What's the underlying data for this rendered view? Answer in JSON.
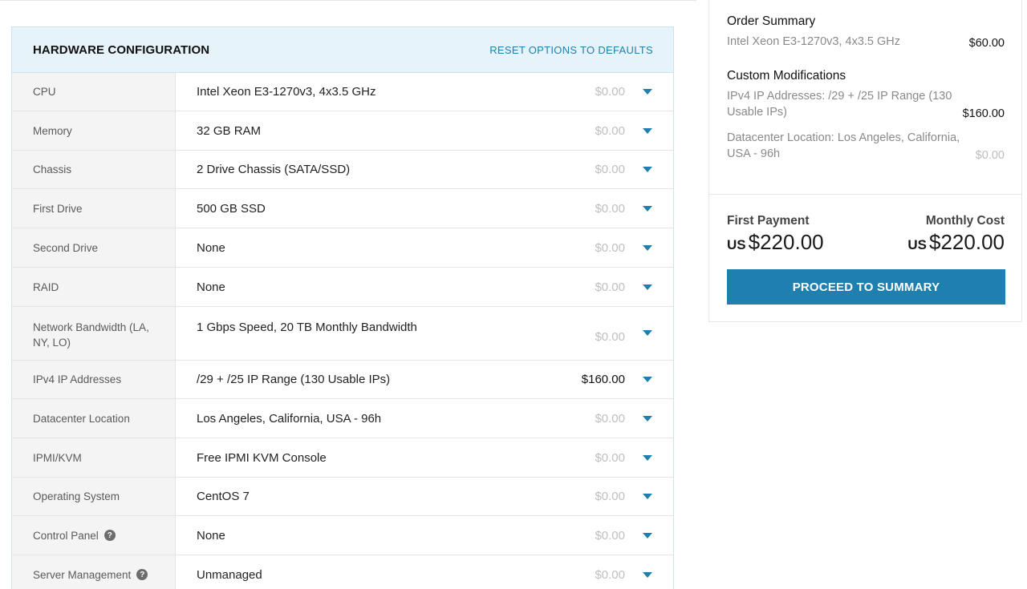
{
  "config": {
    "title": "HARDWARE CONFIGURATION",
    "reset_label": "RESET OPTIONS TO DEFAULTS",
    "rows": [
      {
        "label": "CPU",
        "value": "Intel Xeon E3-1270v3, 4x3.5 GHz",
        "price": "$0.00",
        "active": false,
        "help": false
      },
      {
        "label": "Memory",
        "value": "32 GB RAM",
        "price": "$0.00",
        "active": false,
        "help": false
      },
      {
        "label": "Chassis",
        "value": "2 Drive Chassis (SATA/SSD)",
        "price": "$0.00",
        "active": false,
        "help": false
      },
      {
        "label": "First Drive",
        "value": "500 GB SSD",
        "price": "$0.00",
        "active": false,
        "help": false
      },
      {
        "label": "Second Drive",
        "value": "None",
        "price": "$0.00",
        "active": false,
        "help": false
      },
      {
        "label": "RAID",
        "value": "None",
        "price": "$0.00",
        "active": false,
        "help": false
      },
      {
        "label": "Network Bandwidth (LA, NY, LO)",
        "value": "1 Gbps Speed, 20 TB Monthly Bandwidth",
        "price": "$0.00",
        "active": false,
        "help": false,
        "tall": true
      },
      {
        "label": "IPv4 IP Addresses",
        "value": "/29 + /25 IP Range (130 Usable IPs)",
        "price": "$160.00",
        "active": true,
        "help": false
      },
      {
        "label": "Datacenter Location",
        "value": "Los Angeles, California, USA - 96h",
        "price": "$0.00",
        "active": false,
        "help": false
      },
      {
        "label": "IPMI/KVM",
        "value": "Free IPMI KVM Console",
        "price": "$0.00",
        "active": false,
        "help": false
      },
      {
        "label": "Operating System",
        "value": "CentOS 7",
        "price": "$0.00",
        "active": false,
        "help": false
      },
      {
        "label": "Control Panel",
        "value": "None",
        "price": "$0.00",
        "active": false,
        "help": true
      },
      {
        "label": "Server Management",
        "value": "Unmanaged",
        "price": "$0.00",
        "active": false,
        "help": true
      }
    ]
  },
  "summary": {
    "order_title": "Order Summary",
    "order_item": "Intel Xeon E3-1270v3, 4x3.5 GHz",
    "order_price": "$60.00",
    "custom_title": "Custom Modifications",
    "mods": [
      {
        "desc": "IPv4 IP Addresses: /29 + /25 IP Range (130 Usable IPs)",
        "price": "$160.00",
        "muted": false
      },
      {
        "desc": "Datacenter Location: Los Angeles, California, USA - 96h",
        "price": "$0.00",
        "muted": true
      }
    ],
    "first_payment_label": "First Payment",
    "first_payment_currency": "US",
    "first_payment_amount": "$220.00",
    "monthly_cost_label": "Monthly Cost",
    "monthly_cost_currency": "US",
    "monthly_cost_amount": "$220.00",
    "proceed_label": "PROCEED TO SUMMARY"
  },
  "icons": {
    "dropdown": "caret-down-icon",
    "help": "question-circle-icon"
  },
  "colors": {
    "accent": "#1f7fae",
    "header_bg": "#e6f3fa",
    "label_bg": "#f4f4f4"
  }
}
